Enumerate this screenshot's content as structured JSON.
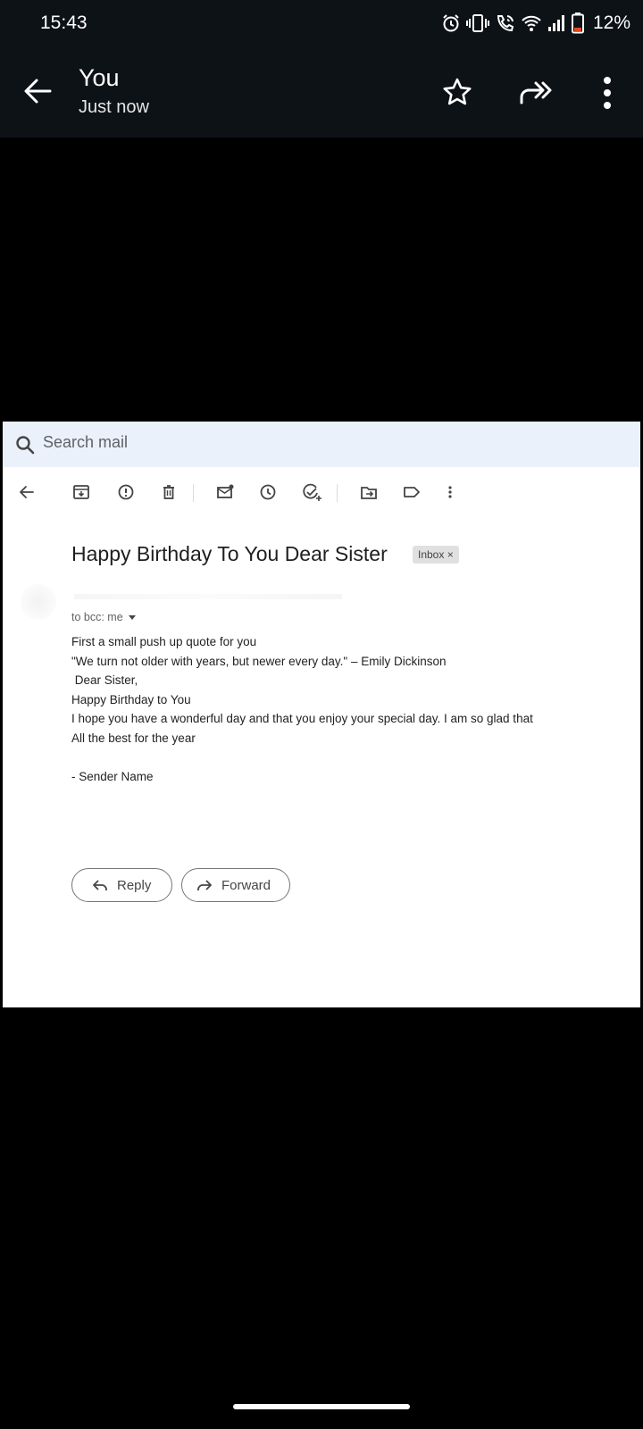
{
  "status_bar": {
    "time": "15:43",
    "battery_percent": "12%",
    "icons": [
      "alarm-icon",
      "vibrate-icon",
      "wifi-calling-icon",
      "wifi-icon",
      "signal-icon",
      "battery-icon"
    ]
  },
  "app_bar": {
    "sender": "You",
    "timestamp": "Just now",
    "icons": [
      "back-arrow-icon",
      "star-icon",
      "forward-all-icon",
      "more-vert-icon"
    ]
  },
  "screenshot": {
    "search": {
      "placeholder": "Search mail"
    },
    "toolbar_icons": [
      "back-arrow-icon",
      "archive-icon",
      "report-spam-icon",
      "delete-icon",
      "mark-unread-icon",
      "snooze-icon",
      "add-task-icon",
      "move-to-icon",
      "label-icon",
      "more-vert-icon"
    ],
    "email": {
      "subject": "Happy Birthday To You Dear Sister",
      "label_chip": "Inbox ×",
      "recipient_line": "to bcc: me",
      "body_lines": [
        "First a small push up quote for you",
        "\"We turn not older with years, but newer every day.\" – Emily Dickinson",
        " Dear Sister,",
        "Happy Birthday to You",
        "I hope you have a wonderful day and that you enjoy your special day. I am so glad that",
        "All the best for the year",
        "",
        "- Sender Name"
      ],
      "reply_label": "Reply",
      "forward_label": "Forward"
    }
  },
  "colors": {
    "bar_background": "#0d1217",
    "search_background": "#eaf1fb",
    "battery_low": "#e04a1f"
  }
}
